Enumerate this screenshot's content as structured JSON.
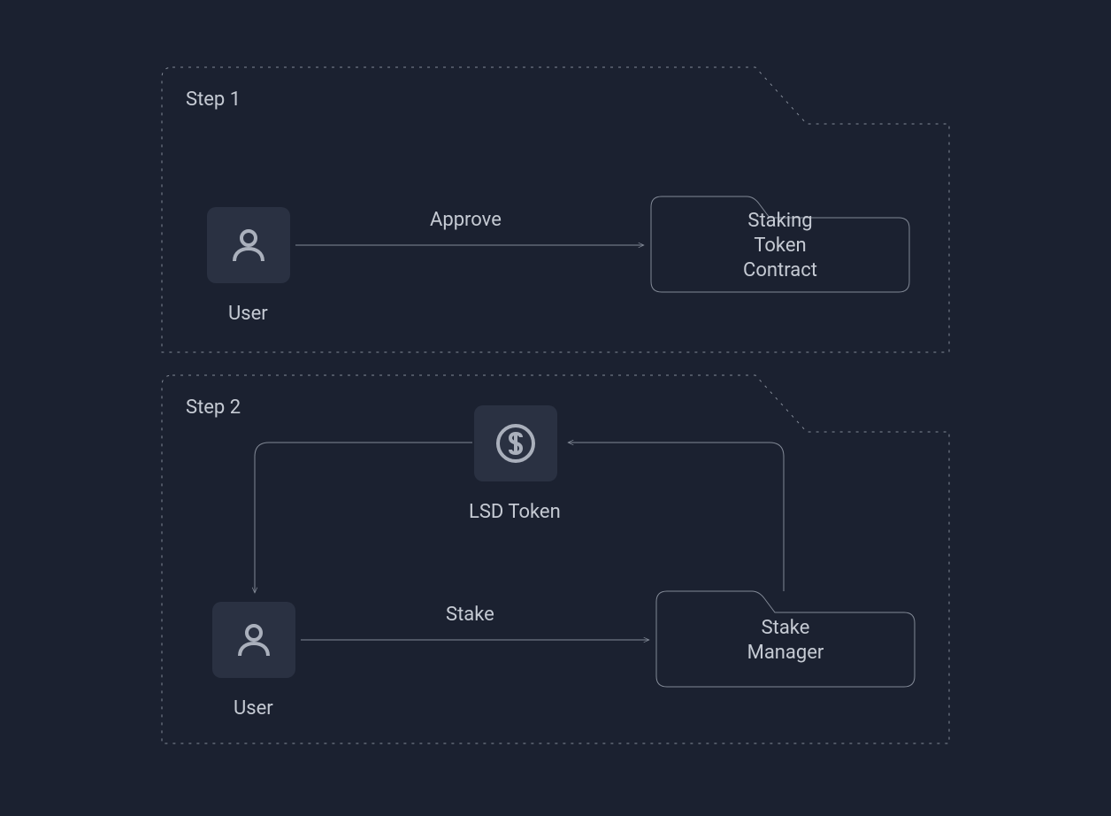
{
  "steps": {
    "step1": {
      "title": "Step 1",
      "user_label": "User",
      "edge_label": "Approve",
      "contract": {
        "line1": "Staking",
        "line2": "Token",
        "line3": "Contract"
      }
    },
    "step2": {
      "title": "Step 2",
      "user_label": "User",
      "edge_label": "Stake",
      "lsd_label": "LSD Token",
      "manager": {
        "line1": "Stake",
        "line2": "Manager"
      }
    }
  },
  "colors": {
    "background": "#1b2130",
    "stroke": "#828996",
    "text": "#c5cad3",
    "tile": "#2a3142"
  }
}
